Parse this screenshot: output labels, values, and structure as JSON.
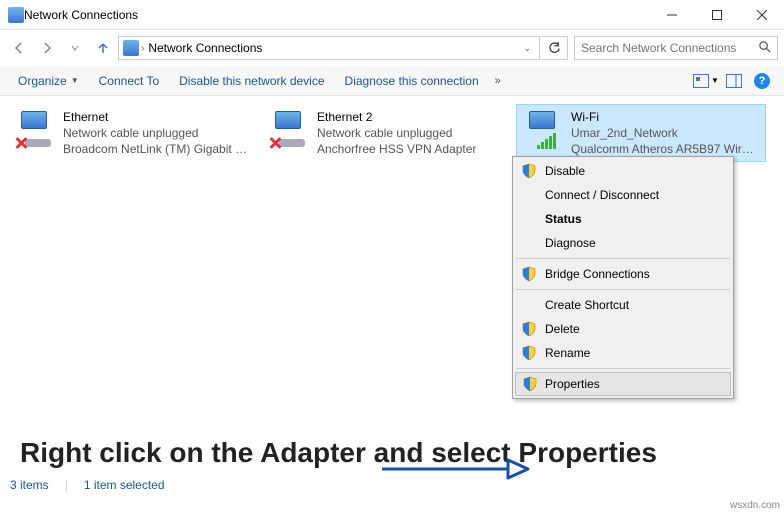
{
  "title": "Network Connections",
  "breadcrumb": {
    "root_arrow": "›",
    "label": "Network Connections"
  },
  "search": {
    "placeholder": "Search Network Connections"
  },
  "toolbar": {
    "organize": "Organize",
    "connect_to": "Connect To",
    "disable": "Disable this network device",
    "diagnose": "Diagnose this connection"
  },
  "adapters": [
    {
      "name": "Ethernet",
      "status": "Network cable unplugged",
      "device": "Broadcom NetLink (TM) Gigabit E...",
      "disconnected": true,
      "wifi": false
    },
    {
      "name": "Ethernet 2",
      "status": "Network cable unplugged",
      "device": "Anchorfree HSS VPN Adapter",
      "disconnected": true,
      "wifi": false
    },
    {
      "name": "Wi-Fi",
      "status": "Umar_2nd_Network",
      "device": "Qualcomm Atheros AR5B97 Wirel...",
      "disconnected": false,
      "wifi": true,
      "selected": true
    }
  ],
  "context_menu": {
    "disable": "Disable",
    "connect": "Connect / Disconnect",
    "status": "Status",
    "diagnose": "Diagnose",
    "bridge": "Bridge Connections",
    "shortcut": "Create Shortcut",
    "delete": "Delete",
    "rename": "Rename",
    "properties": "Properties"
  },
  "annotation": "Right click on the Adapter and select Properties",
  "statusbar": {
    "count": "3 items",
    "selected": "1 item selected"
  },
  "watermark": "wsxdn.com"
}
